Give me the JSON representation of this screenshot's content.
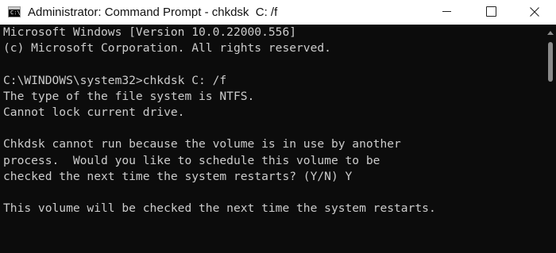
{
  "window": {
    "title": "Administrator: Command Prompt - chkdsk  C: /f",
    "icon": "C:\\",
    "controls": {
      "minimize": "minimize-icon",
      "maximize": "maximize-icon",
      "close": "close-icon"
    }
  },
  "terminal": {
    "lines": [
      "Microsoft Windows [Version 10.0.22000.556]",
      "(c) Microsoft Corporation. All rights reserved.",
      "",
      "C:\\WINDOWS\\system32>chkdsk C: /f",
      "The type of the file system is NTFS.",
      "Cannot lock current drive.",
      "",
      "Chkdsk cannot run because the volume is in use by another",
      "process.  Would you like to schedule this volume to be",
      "checked the next time the system restarts? (Y/N) Y",
      "",
      "This volume will be checked the next time the system restarts."
    ]
  },
  "colors": {
    "background": "#0c0c0c",
    "text": "#cccccc",
    "titlebar": "#ffffff"
  }
}
